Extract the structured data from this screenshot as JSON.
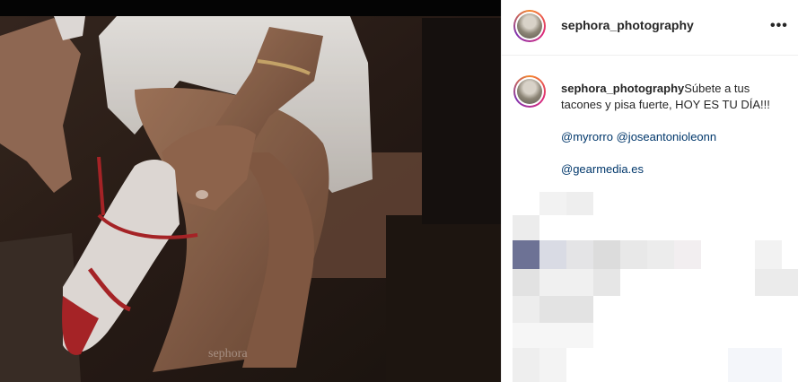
{
  "post": {
    "username": "sephora_photography",
    "photo_watermark": "sephora",
    "caption_text": "Súbete a tus tacones y pisa fuerte, HOY ES TU DÍA!!!",
    "mentions_line1": [
      "@myrorro",
      "@joseantonioleonn"
    ],
    "mention_line2": "@gearmedia.es",
    "more_icon": "more-horizontal-icon"
  },
  "colors": {
    "story_ring": [
      "#f58529",
      "#dd2a7b",
      "#8134af"
    ],
    "mention": "#00376b",
    "shoe_red": "#b3262a"
  }
}
